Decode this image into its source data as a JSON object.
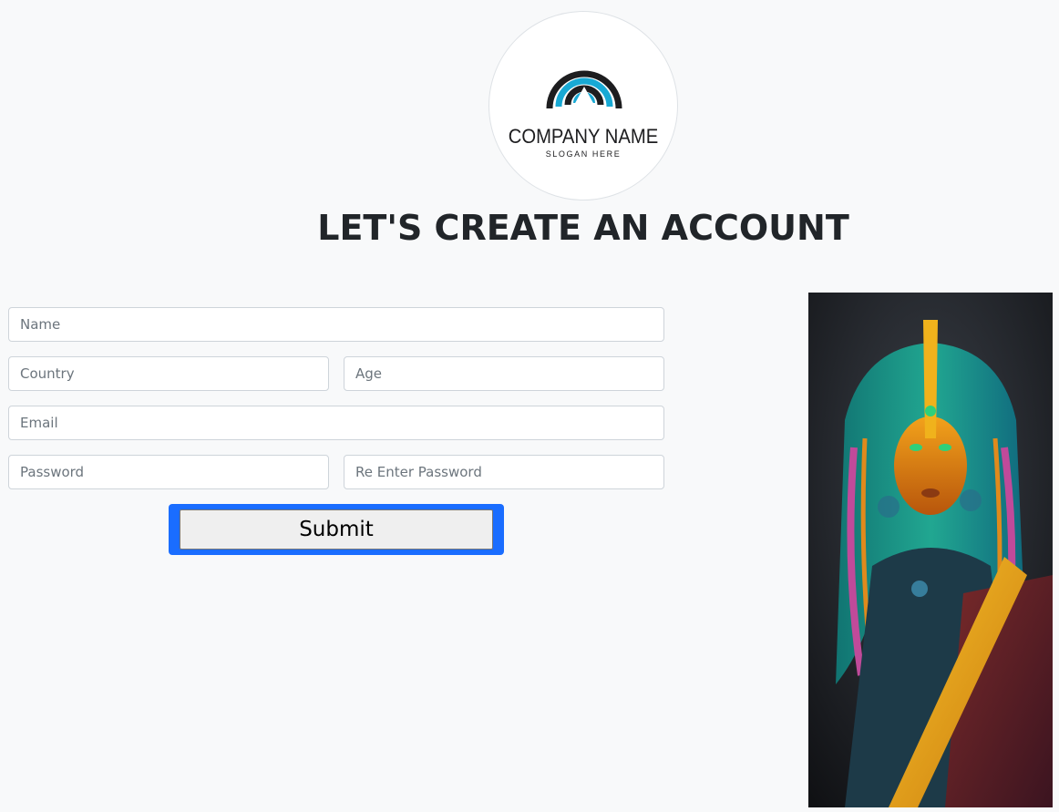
{
  "logo": {
    "company_name": "COMPANY NAME",
    "slogan": "SLOGAN HERE",
    "accent_color": "#18a9d4",
    "dark_color": "#1d1d1f"
  },
  "heading": "LET'S CREATE AN ACCOUNT",
  "form": {
    "name": {
      "placeholder": "Name",
      "value": ""
    },
    "country": {
      "placeholder": "Country",
      "value": ""
    },
    "age": {
      "placeholder": "Age",
      "value": ""
    },
    "email": {
      "placeholder": "Email",
      "value": ""
    },
    "password": {
      "placeholder": "Password",
      "value": ""
    },
    "re_password": {
      "placeholder": "Re Enter Password",
      "value": ""
    },
    "submit_label": "Submit",
    "submit_focus_color": "#1a6dff"
  },
  "artwork": {
    "subject": "stylized-cyber-woman-portrait"
  }
}
